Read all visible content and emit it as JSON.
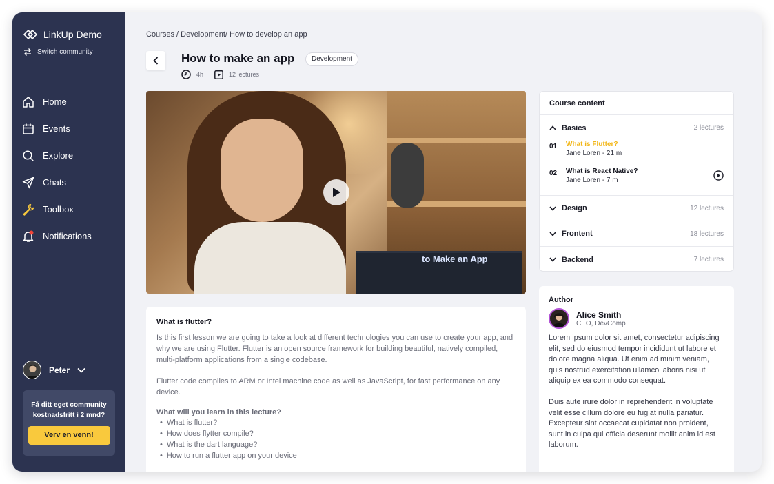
{
  "sidebar": {
    "brand": "LinkUp Demo",
    "switch_label": "Switch community",
    "nav": [
      {
        "label": "Home",
        "icon": "home-icon"
      },
      {
        "label": "Events",
        "icon": "calendar-icon"
      },
      {
        "label": "Explore",
        "icon": "search-icon"
      },
      {
        "label": "Chats",
        "icon": "send-icon"
      },
      {
        "label": "Toolbox",
        "icon": "wrench-icon"
      },
      {
        "label": "Notifications",
        "icon": "bell-icon"
      }
    ],
    "user": {
      "name": "Peter"
    },
    "promo": {
      "text": "Få ditt eget community kostnadsfritt i 2 mnd?",
      "button": "Verv en venn!"
    }
  },
  "breadcrumb": "Courses / Development/ How to develop an app",
  "course": {
    "title": "How to make an app",
    "tag": "Development",
    "duration": "4h",
    "lectures": "12 lectures"
  },
  "video": {
    "screen_text": "to Make an App"
  },
  "lesson": {
    "title": "What is flutter?",
    "paragraph1": "Is this first lesson we are going to take a look at different technologies you can use to create your app, and why we are using Flutter.  Flutter is an open source framework for building beautiful, natively compiled, multi-platform applications from a single codebase.",
    "paragraph2": "Flutter code compiles to ARM or Intel machine code as well as JavaScript, for fast performance on any device.",
    "learn_title": "What will you learn in this lecture?",
    "learn_items": [
      "What is flutter?",
      "How does flytter compile?",
      "What is the dart language?",
      "How to run a flutter app on your device"
    ]
  },
  "course_content": {
    "title": "Course content",
    "sections": [
      {
        "label": "Basics",
        "count": "2 lectures"
      },
      {
        "label": "Design",
        "count": "12 lectures"
      },
      {
        "label": "Frontent",
        "count": "18 lectures"
      },
      {
        "label": "Backend",
        "count": "7 lectures"
      }
    ],
    "basics_lectures": [
      {
        "num": "01",
        "name": "What is Flutter?",
        "author": "Jane Loren - 21 m"
      },
      {
        "num": "02",
        "name": "What is React Native?",
        "author": "Jane Loren - 7 m"
      }
    ]
  },
  "author": {
    "heading": "Author",
    "name": "Alice Smith",
    "role": "CEO, DevComp",
    "bio1": "Lorem ipsum dolor sit amet, consectetur adipiscing elit, sed do eiusmod tempor incididunt ut labore et dolore magna aliqua. Ut enim ad minim veniam, quis nostrud exercitation ullamco laboris nisi ut aliquip ex ea commodo consequat.",
    "bio2": "Duis aute irure dolor in reprehenderit in voluptate velit esse cillum dolore eu fugiat nulla pariatur. Excepteur sint occaecat cupidatat non proident, sunt in culpa qui officia deserunt mollit anim id est laborum."
  },
  "colors": {
    "sidebar": "#2c3350",
    "accent_yellow": "#f9c93d",
    "active_lecture": "#f2b616",
    "notification_dot": "#f04438",
    "author_ring": "#b253d5"
  }
}
